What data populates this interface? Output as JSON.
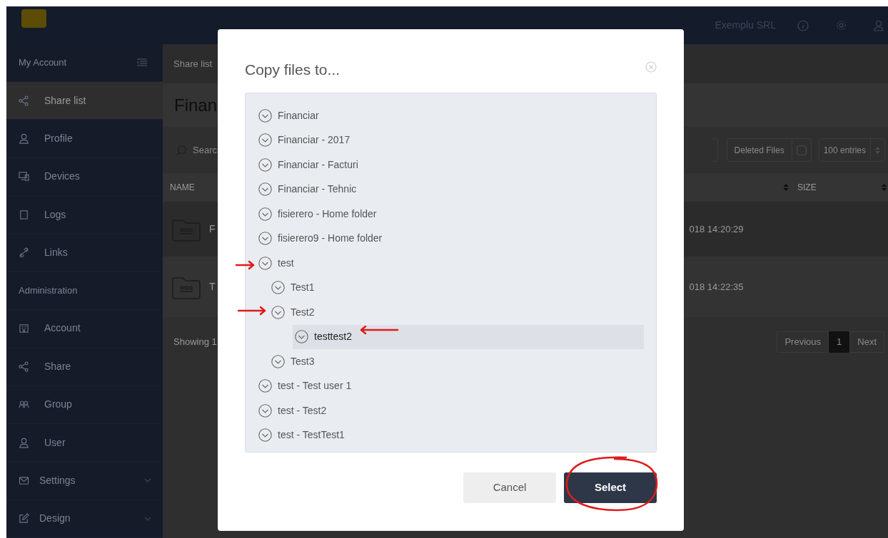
{
  "topbar": {
    "company": "Exemplu SRL"
  },
  "sidebar": {
    "sections": [
      {
        "title": "My Account",
        "items": [
          {
            "label": "Share list",
            "selected": true,
            "has_submenu": false
          },
          {
            "label": "Profile",
            "selected": false,
            "has_submenu": false
          },
          {
            "label": "Devices",
            "selected": false,
            "has_submenu": false
          },
          {
            "label": "Logs",
            "selected": false,
            "has_submenu": false
          },
          {
            "label": "Links",
            "selected": false,
            "has_submenu": false
          }
        ]
      },
      {
        "title": "Administration",
        "items": [
          {
            "label": "Account",
            "selected": false,
            "has_submenu": false
          },
          {
            "label": "Share",
            "selected": false,
            "has_submenu": false
          },
          {
            "label": "Group",
            "selected": false,
            "has_submenu": false
          },
          {
            "label": "User",
            "selected": false,
            "has_submenu": false
          },
          {
            "label": "Settings",
            "selected": false,
            "has_submenu": true
          },
          {
            "label": "Design",
            "selected": false,
            "has_submenu": true
          }
        ]
      }
    ]
  },
  "main": {
    "breadcrumb": "Share list",
    "title": "Finan",
    "search_placeholder": "Searc",
    "deleted_files": {
      "label": "Deleted Files",
      "checked": false
    },
    "entries_select": "100 entries",
    "columns": [
      "NAME",
      "SIZE"
    ],
    "rows": [
      {
        "name": "F",
        "date": "018 14:20:29"
      },
      {
        "name": "T",
        "date": "018 14:22:35"
      }
    ],
    "footer": "Showing 1",
    "pagination": [
      {
        "label": "Previous",
        "selected": false
      },
      {
        "label": "1",
        "selected": true
      },
      {
        "label": "Next",
        "selected": false
      }
    ]
  },
  "dialog": {
    "title": "Copy files to...",
    "tree": [
      {
        "label": "Financiar",
        "selected": false
      },
      {
        "label": "Financiar - 2017",
        "selected": false
      },
      {
        "label": "Financiar - Facturi",
        "selected": false
      },
      {
        "label": "Financiar - Tehnic",
        "selected": false
      },
      {
        "label": "fisierero - Home folder",
        "selected": false
      },
      {
        "label": "fisierero9 - Home folder",
        "selected": false
      },
      {
        "label": "test",
        "selected": false,
        "children": [
          {
            "label": "Test1",
            "selected": false
          },
          {
            "label": "Test2",
            "selected": false,
            "children": [
              {
                "label": "testtest2",
                "selected": true
              }
            ]
          },
          {
            "label": "Test3",
            "selected": false
          }
        ]
      },
      {
        "label": "test - Test user 1",
        "selected": false
      },
      {
        "label": "test - Test2",
        "selected": false
      },
      {
        "label": "test - TestTest1",
        "selected": false
      }
    ],
    "buttons": [
      {
        "label": "Cancel",
        "kind": "secondary"
      },
      {
        "label": "Select",
        "kind": "primary"
      }
    ]
  }
}
